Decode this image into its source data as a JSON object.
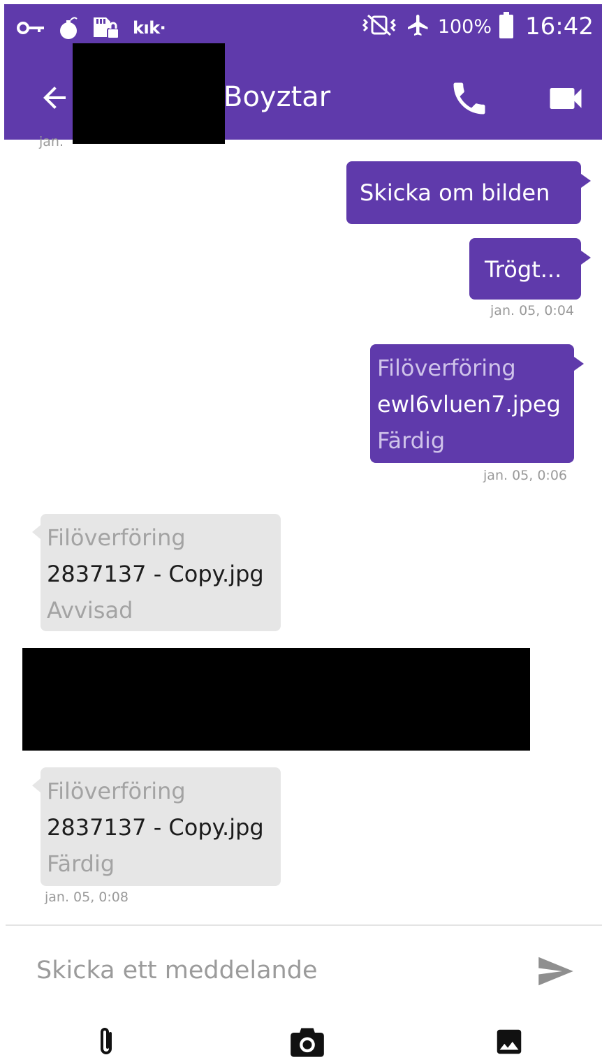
{
  "status_bar": {
    "app_label": "kık·",
    "battery": "100%",
    "time": "16:42",
    "icons": [
      "key-icon",
      "bomb-icon",
      "sd-card-lock-icon",
      "vibrate-off-icon",
      "airplane-mode-icon",
      "battery-icon"
    ]
  },
  "app_bar": {
    "contact_name": "Boyztar",
    "icons": [
      "back-arrow-icon",
      "phone-icon",
      "video-camera-icon"
    ]
  },
  "conversation": {
    "clipped_timestamp": "jan.",
    "messages": [
      {
        "direction": "out",
        "text": "Skicka om bilden"
      },
      {
        "direction": "out",
        "text": "Trögt...",
        "timestamp": "jan. 05, 0:04"
      },
      {
        "direction": "out",
        "type": "file",
        "title": "Filöverföring",
        "filename": "ewl6vluen7.jpeg",
        "status": "Färdig",
        "timestamp": "jan. 05, 0:06"
      },
      {
        "direction": "in",
        "type": "file",
        "title": "Filöverföring",
        "filename": "2837137 - Copy.jpg",
        "status": "Avvisad"
      },
      {
        "direction": "in",
        "type": "file",
        "title": "Filöverföring",
        "filename": "2837137 - Copy.jpg",
        "status": "Färdig",
        "timestamp": "jan. 05, 0:08"
      }
    ]
  },
  "composer": {
    "placeholder": "Skicka ett meddelande",
    "value": "",
    "icons": [
      "send-icon",
      "paperclip-icon",
      "camera-icon",
      "image-icon"
    ]
  },
  "colors": {
    "primary": "#5f3aab",
    "incoming_bubble": "#e6e6e6",
    "timestamp": "#9a9a9a",
    "redaction": "#000000"
  }
}
